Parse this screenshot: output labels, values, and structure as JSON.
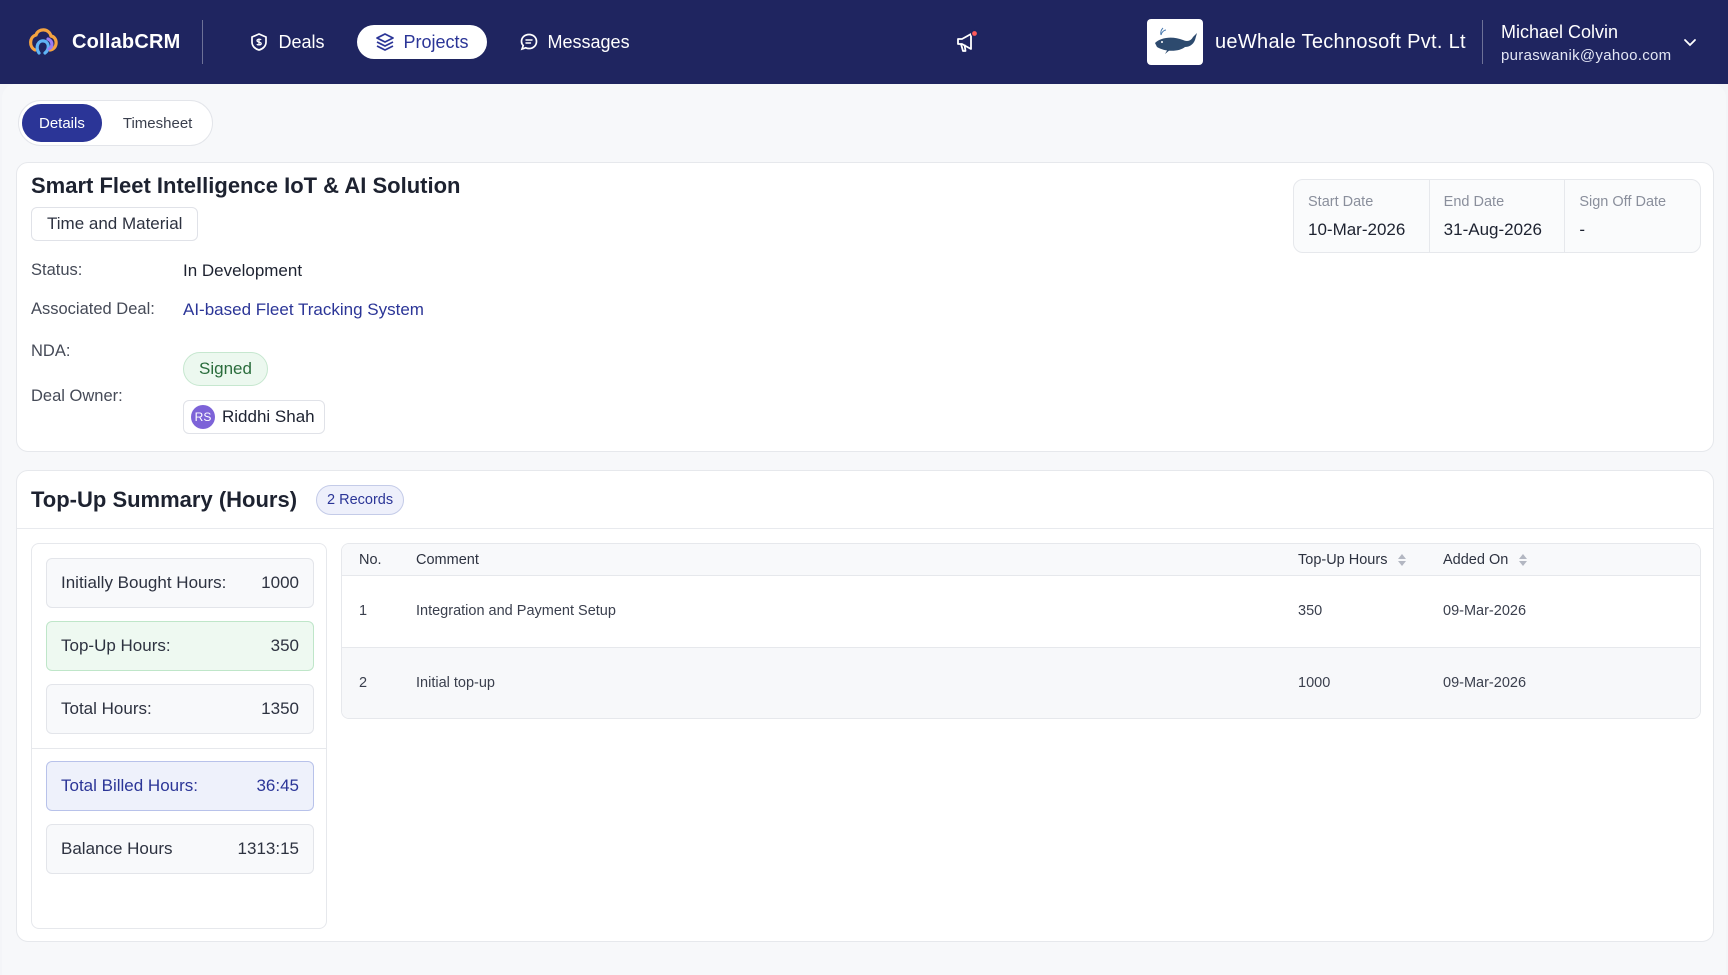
{
  "navbar": {
    "brand": "CollabCRM",
    "items": [
      {
        "label": "Deals",
        "icon": "shield-icon"
      },
      {
        "label": "Projects",
        "icon": "layers-icon"
      },
      {
        "label": "Messages",
        "icon": "chat-icon"
      }
    ],
    "org_name": "ueWhale Technosoft Pvt. Lt",
    "user_name": "Michael Colvin",
    "user_email": "puraswanik@yahoo.com"
  },
  "tabs": [
    "Details",
    "Timesheet"
  ],
  "project": {
    "title": "Smart Fleet Intelligence IoT & AI Solution",
    "type": "Time and Material",
    "status_label": "Status:",
    "status_value": "In Development",
    "deal_label": "Associated Deal:",
    "deal_value": "AI-based Fleet Tracking System",
    "nda_label": "NDA:",
    "nda_value": "Signed",
    "owner_label": "Deal Owner:",
    "owner_initials": "RS",
    "owner_name": "Riddhi Shah",
    "dates": [
      {
        "label": "Start Date",
        "value": "10-Mar-2026"
      },
      {
        "label": "End Date",
        "value": "31-Aug-2026"
      },
      {
        "label": "Sign Off Date",
        "value": "-"
      }
    ]
  },
  "topup": {
    "title": "Top-Up Summary (Hours)",
    "records_badge": "2 Records",
    "summary": [
      {
        "label": "Initially Bought Hours:",
        "value": "1000"
      },
      {
        "label": "Top-Up Hours:",
        "value": "350"
      },
      {
        "label": "Total Hours:",
        "value": "1350"
      },
      {
        "label": "Total Billed Hours:",
        "value": "36:45"
      },
      {
        "label": "Balance Hours",
        "value": "1313:15"
      }
    ],
    "columns": [
      "No.",
      "Comment",
      "Top-Up Hours",
      "Added On"
    ],
    "rows": [
      {
        "no": "1",
        "comment": "Integration and Payment Setup",
        "hours": "350",
        "added_on": "09-Mar-2026"
      },
      {
        "no": "2",
        "comment": "Initial top-up",
        "hours": "1000",
        "added_on": "09-Mar-2026"
      }
    ]
  },
  "colors": {
    "navbar": "#1f2560",
    "accent": "#2b3597",
    "success": "#2a6c3c"
  }
}
